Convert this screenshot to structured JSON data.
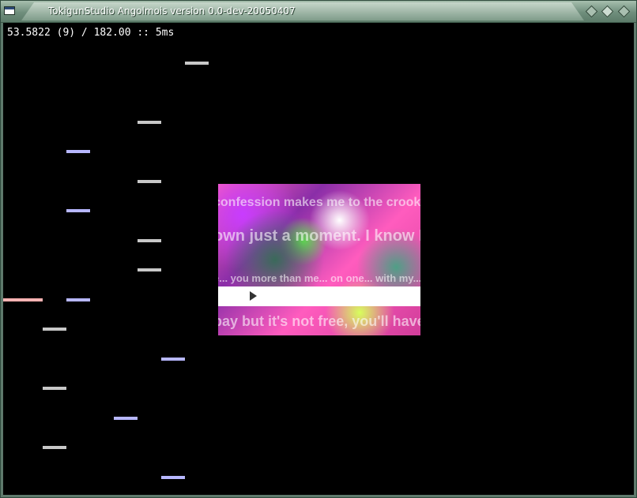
{
  "window": {
    "title": "TokigunStudio Angolmois version 0.0-dev-20050407"
  },
  "hud": {
    "status": "53.5822 (9) / 182.00 :: 5ms"
  },
  "bga": {
    "lines": [
      "confession makes me to the crooked man who...",
      "own just a moment. I know I let you",
      "e... you more than me... on one... with my...",
      "pay but it's not free, you'll have to"
    ],
    "play_icon": "play-icon"
  },
  "notes": {
    "colors": {
      "white": "#c8c8c8",
      "blue": "#b7b7ff",
      "red": "#ffb3b3"
    }
  }
}
